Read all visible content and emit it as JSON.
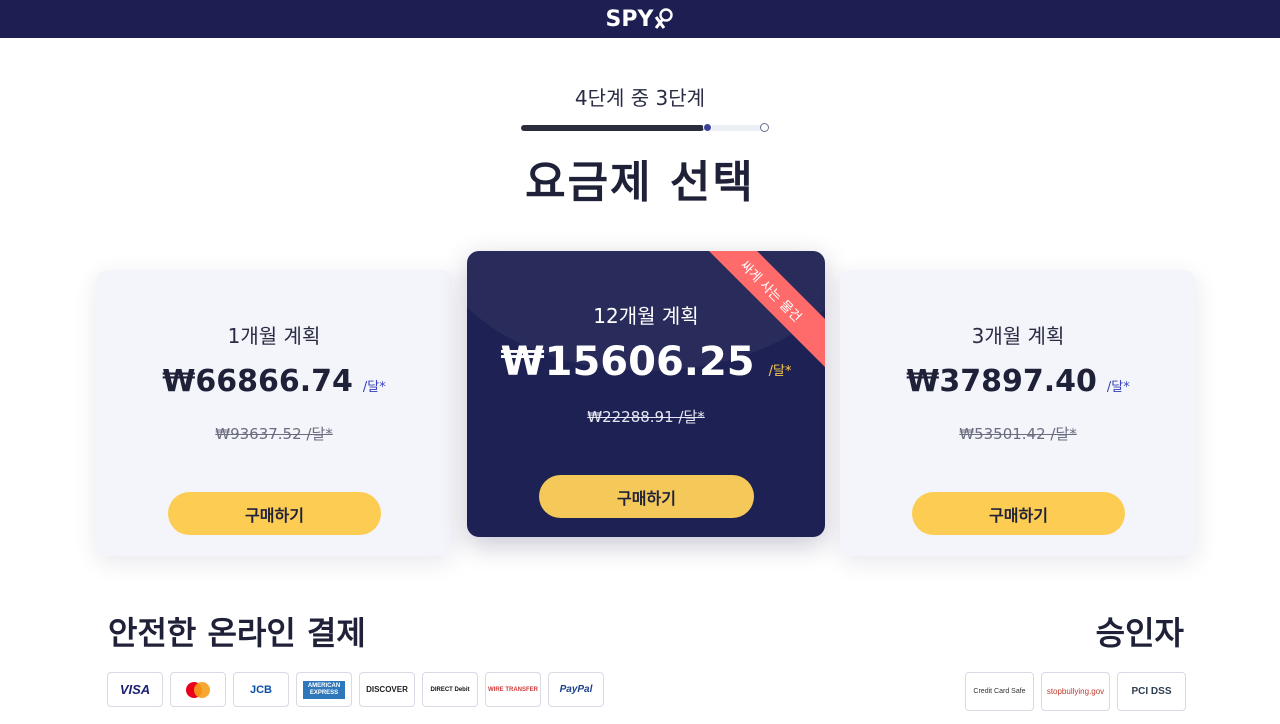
{
  "header": {
    "logo_text": "SPY"
  },
  "stepper": {
    "text": "4단계 중 3단계",
    "progress": 0.75
  },
  "page_title": "요금제 선택",
  "plans": [
    {
      "name": "1개월 계획",
      "price": "₩66866.74",
      "per": "/달*",
      "old_price": "₩93637.52 /달*",
      "button": "구매하기"
    },
    {
      "name": "12개월 계획",
      "price": "₩15606.25",
      "per": "/달*",
      "old_price": "₩22288.91 /달*",
      "button": "구매하기",
      "ribbon": "싸게 사는 물건",
      "featured": true
    },
    {
      "name": "3개월 계획",
      "price": "₩37897.40",
      "per": "/달*",
      "old_price": "₩53501.42 /달*",
      "button": "구매하기"
    }
  ],
  "payment": {
    "title": "안전한 온라인 결제",
    "methods": [
      "VISA",
      "mastercard-icon",
      "JCB",
      "AMERICAN EXPRESS",
      "DISCOVER",
      "DIRECT Debit",
      "WIRE TRANSFER",
      "PayPal"
    ]
  },
  "approved": {
    "title": "승인자",
    "badges": [
      "Credit Card Safe",
      "stopbullying.gov",
      "PCI DSS"
    ]
  },
  "colors": {
    "navy": "#1d1f52",
    "yellow": "#fdcc52",
    "ribbon": "#ff6b6b",
    "accent": "#3640b5"
  }
}
